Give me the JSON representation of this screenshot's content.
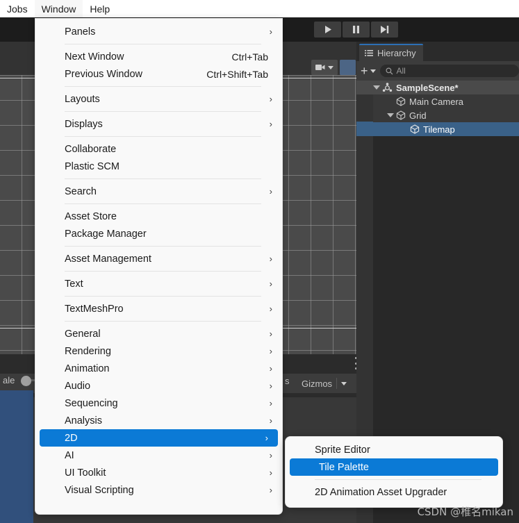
{
  "menubar": {
    "items": [
      {
        "label": "Jobs",
        "active": false
      },
      {
        "label": "Window",
        "active": true
      },
      {
        "label": "Help",
        "active": false
      }
    ]
  },
  "toolbar": {
    "play_icon": "play-icon",
    "pause_icon": "pause-icon",
    "step_icon": "step-icon"
  },
  "scene_toolbar": {
    "camera_icon": "camera-icon",
    "gizmo_icon": "globe-gizmo-icon",
    "kebab_icon": "kebab-menu-icon"
  },
  "scene_footer": {
    "scale_label": "ale",
    "flags_label": "s",
    "gizmos_label": "Gizmos"
  },
  "hierarchy": {
    "tab_label": "Hierarchy",
    "tab_icon": "hierarchy-icon",
    "add_label": "+",
    "search_placeholder": "All",
    "search_value": "All",
    "search_icon": "search-icon",
    "rows": [
      {
        "label": "SampleScene*",
        "icon": "scene-icon",
        "depth": 0,
        "expanded": true,
        "selected": false,
        "is_scene": true
      },
      {
        "label": "Main Camera",
        "icon": "gameobject-icon",
        "depth": 1,
        "expanded": false,
        "selected": false,
        "is_scene": false
      },
      {
        "label": "Grid",
        "icon": "gameobject-icon",
        "depth": 1,
        "expanded": true,
        "selected": false,
        "is_scene": false
      },
      {
        "label": "Tilemap",
        "icon": "gameobject-icon",
        "depth": 2,
        "expanded": false,
        "selected": true,
        "is_scene": false
      }
    ]
  },
  "window_menu": {
    "groups": [
      [
        {
          "label": "Panels",
          "submenu": true,
          "shortcut": ""
        }
      ],
      [
        {
          "label": "Next Window",
          "submenu": false,
          "shortcut": "Ctrl+Tab"
        },
        {
          "label": "Previous Window",
          "submenu": false,
          "shortcut": "Ctrl+Shift+Tab"
        }
      ],
      [
        {
          "label": "Layouts",
          "submenu": true,
          "shortcut": ""
        }
      ],
      [
        {
          "label": "Displays",
          "submenu": true,
          "shortcut": ""
        }
      ],
      [
        {
          "label": "Collaborate",
          "submenu": false,
          "shortcut": ""
        },
        {
          "label": "Plastic SCM",
          "submenu": false,
          "shortcut": ""
        }
      ],
      [
        {
          "label": "Search",
          "submenu": true,
          "shortcut": ""
        }
      ],
      [
        {
          "label": "Asset Store",
          "submenu": false,
          "shortcut": ""
        },
        {
          "label": "Package Manager",
          "submenu": false,
          "shortcut": ""
        }
      ],
      [
        {
          "label": "Asset Management",
          "submenu": true,
          "shortcut": ""
        }
      ],
      [
        {
          "label": "Text",
          "submenu": true,
          "shortcut": ""
        }
      ],
      [
        {
          "label": "TextMeshPro",
          "submenu": true,
          "shortcut": ""
        }
      ],
      [
        {
          "label": "General",
          "submenu": true,
          "shortcut": ""
        },
        {
          "label": "Rendering",
          "submenu": true,
          "shortcut": ""
        },
        {
          "label": "Animation",
          "submenu": true,
          "shortcut": ""
        },
        {
          "label": "Audio",
          "submenu": true,
          "shortcut": ""
        },
        {
          "label": "Sequencing",
          "submenu": true,
          "shortcut": ""
        },
        {
          "label": "Analysis",
          "submenu": true,
          "shortcut": ""
        },
        {
          "label": "2D",
          "submenu": true,
          "shortcut": "",
          "highlighted": true
        },
        {
          "label": "AI",
          "submenu": true,
          "shortcut": ""
        },
        {
          "label": "UI Toolkit",
          "submenu": true,
          "shortcut": ""
        },
        {
          "label": "Visual Scripting",
          "submenu": true,
          "shortcut": ""
        }
      ]
    ]
  },
  "submenu_2d": {
    "groups": [
      [
        {
          "label": "Sprite Editor",
          "highlighted": false
        },
        {
          "label": "Tile Palette",
          "highlighted": true
        }
      ],
      [
        {
          "label": "2D Animation Asset Upgrader",
          "highlighted": false
        }
      ]
    ]
  },
  "watermark": {
    "text": "CSDN @椎名mikan"
  },
  "colors": {
    "menu_bg": "#f9f9f9",
    "highlight": "#0b7ad6",
    "editor_bg": "#383838",
    "selection_blue": "#3a6188",
    "panel_blue": "#31507c",
    "tab_accent": "#2c6fb5"
  }
}
